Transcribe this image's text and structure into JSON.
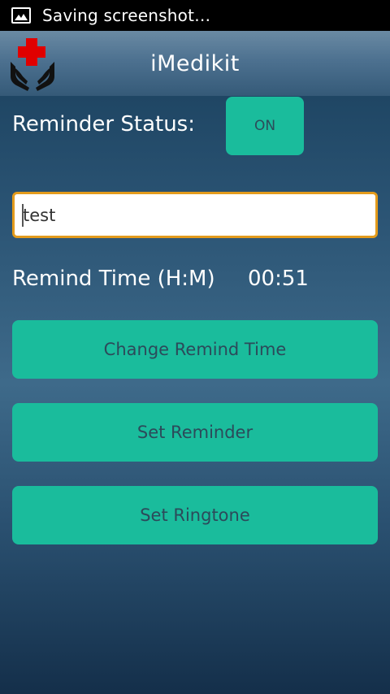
{
  "status_bar": {
    "notification_text": "Saving screenshot…",
    "icon": "image-icon"
  },
  "header": {
    "app_title": "iMedikit",
    "logo_icon": "medical-cross-hands-icon"
  },
  "reminder": {
    "status_label": "Reminder Status:",
    "status_toggle": "ON",
    "name_value": "test",
    "time_label": "Remind Time (H:M)",
    "time_value": "00:51"
  },
  "buttons": {
    "change_time": "Change Remind Time",
    "set_reminder": "Set Reminder",
    "set_ringtone": "Set Ringtone"
  },
  "colors": {
    "accent": "#1abc9c",
    "input_border": "#e39b1c",
    "logo_cross": "#e00000"
  }
}
